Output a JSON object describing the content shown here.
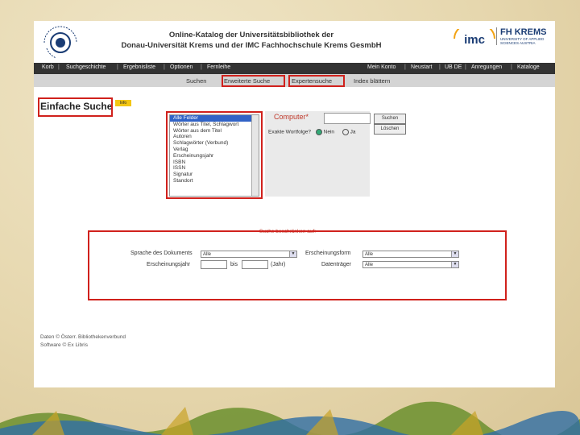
{
  "header": {
    "title_line1": "Online-Katalog der Universitätsbibliothek der",
    "title_line2": "Donau-Universität Krems und der IMC Fachhochschule Krems GesmbH",
    "logo_donau_text": "DONAU UNIVERSITÄT KREMS",
    "logo_imc_text": "imc",
    "fh_title": "FH KREMS",
    "fh_sub1": "UNIVERSITY OF APPLIED",
    "fh_sub2": "SCIENCES AUSTRIA"
  },
  "nav": {
    "left": [
      "Korb",
      "Suchgeschichte",
      "Ergebnisliste",
      "Optionen",
      "Fernleihe"
    ],
    "right": [
      "Mein Konto",
      "Neustart",
      "UB DE",
      "Anregungen",
      "Kataloge"
    ]
  },
  "tabs": {
    "suchen": "Suchen",
    "erweitert": "Erweiterte Suche",
    "experten": "Expertensuche",
    "index": "Index blättern"
  },
  "search": {
    "heading": "Einfache Suche",
    "info": "Info",
    "fields": [
      "Alle Felder",
      "Wörter aus Titel, Schlagwort",
      "Wörter aus dem Titel",
      "Autoren",
      "Schlagwörter (Verbund)",
      "Verlag",
      "Erscheinungsjahr",
      "ISBN",
      "ISSN",
      "Signatur",
      "Standort"
    ],
    "query": "Computer*",
    "exact_label": "Exakte Wortfolge?",
    "no": "Nein",
    "yes": "Ja",
    "btn_search": "Suchen",
    "btn_clear": "Löschen"
  },
  "restrict": {
    "title": "Suche beschränken auf:",
    "doc_label": "Sprache des Dokuments",
    "doc_value": "Alle",
    "form_label": "Erscheinungsform",
    "form_value": "Alle",
    "year_label": "Erscheinungsjahr",
    "bis": "bis",
    "unit": "(Jahr)",
    "owner_label": "Datenträger",
    "owner_value": "Alle"
  },
  "footer": {
    "line1": "Daten © Österr. Bibliothekenverbund",
    "line2": "Software © Ex Libris"
  }
}
